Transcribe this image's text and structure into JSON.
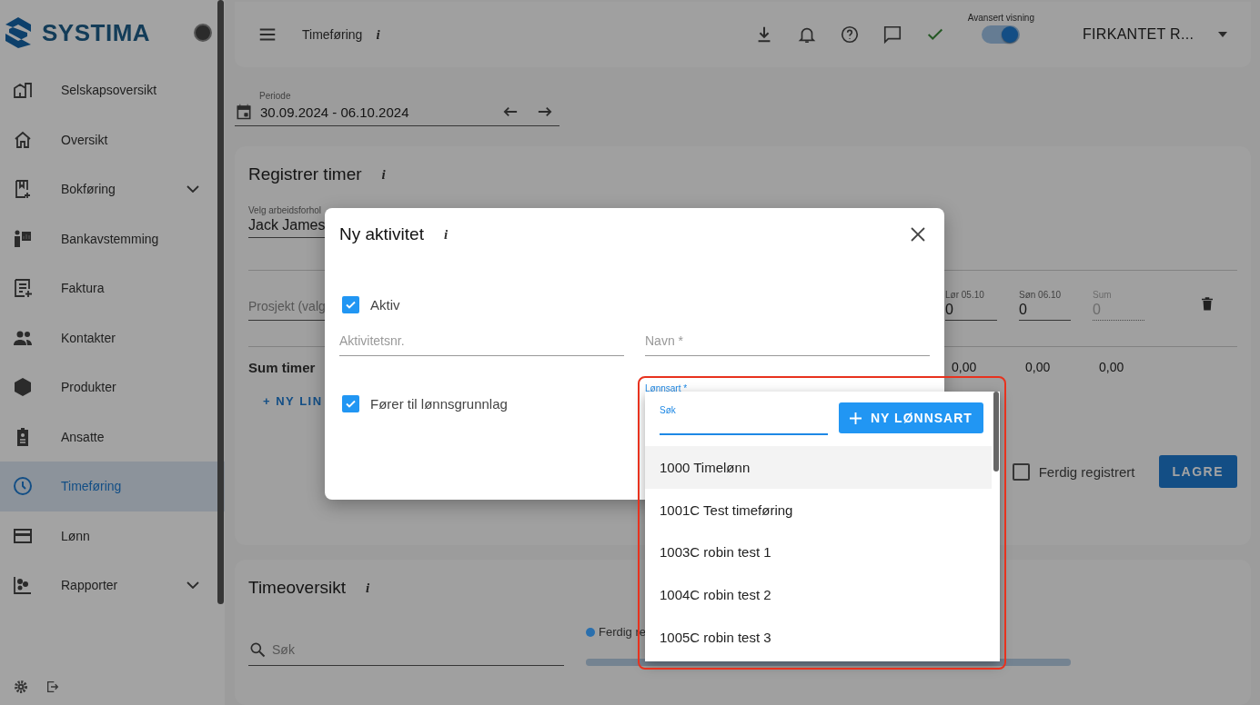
{
  "sidebar": {
    "logo": "SYSTIMA",
    "items": [
      {
        "label": "Selskapsoversikt",
        "selected": false,
        "expandable": false
      },
      {
        "label": "Oversikt",
        "selected": false,
        "expandable": false
      },
      {
        "label": "Bokføring",
        "selected": false,
        "expandable": true
      },
      {
        "label": "Bankavstemming",
        "selected": false,
        "expandable": false
      },
      {
        "label": "Faktura",
        "selected": false,
        "expandable": false
      },
      {
        "label": "Kontakter",
        "selected": false,
        "expandable": false
      },
      {
        "label": "Produkter",
        "selected": false,
        "expandable": false
      },
      {
        "label": "Ansatte",
        "selected": false,
        "expandable": false
      },
      {
        "label": "Timeføring",
        "selected": true,
        "expandable": false
      },
      {
        "label": "Lønn",
        "selected": false,
        "expandable": false
      },
      {
        "label": "Rapporter",
        "selected": false,
        "expandable": true
      }
    ]
  },
  "topbar": {
    "title": "Timeføring",
    "info": "i",
    "advanced_view": {
      "label": "Avansert visning",
      "on": true
    },
    "company": "FIRKANTET R..."
  },
  "period": {
    "label": "Periode",
    "value": "30.09.2024 - 06.10.2024"
  },
  "register": {
    "title": "Registrer timer",
    "info": "i",
    "employment": {
      "label": "Velg arbeidsforhol",
      "value": "Jack James"
    },
    "project": {
      "placeholder": "Prosjekt (valg"
    },
    "columns": [
      {
        "label": "Lør 05.10",
        "value": "0",
        "disabled": false
      },
      {
        "label": "Søn 06.10",
        "value": "0",
        "disabled": false
      },
      {
        "label": "Sum",
        "value": "0",
        "disabled": true
      }
    ],
    "sum_label": "Sum timer",
    "sums": [
      "0,00",
      "0,00",
      "0,00"
    ],
    "add_line": "+ NY LIN",
    "done": {
      "label": "Ferdig registrert",
      "checked": false
    },
    "save": "LAGRE"
  },
  "overview": {
    "title": "Timeoversikt",
    "info": "i",
    "search": {
      "placeholder": "Søk"
    },
    "legend": {
      "label": "Ferdig re",
      "color": "#2a6fad"
    },
    "progress": {
      "level": 1
    }
  },
  "dialog": {
    "title": "Ny aktivitet",
    "info": "i",
    "active": {
      "label": "Aktiv",
      "checked": true
    },
    "number": {
      "placeholder": "Aktivitetsnr."
    },
    "name": {
      "placeholder": "Navn *"
    },
    "payroll": {
      "label": "Fører til lønnsgrunnlag",
      "checked": true
    },
    "wage_type": {
      "label": "Lønnsart *"
    }
  },
  "dropdown": {
    "search_label": "Søk",
    "new_button": "NY LØNNSART",
    "options": [
      {
        "label": "1000 Timelønn",
        "selected": true
      },
      {
        "label": "1001C Test timeføring",
        "selected": false
      },
      {
        "label": "1003C robin test 1",
        "selected": false
      },
      {
        "label": "1004C robin test 2",
        "selected": false
      },
      {
        "label": "1005C robin test 3",
        "selected": false
      }
    ]
  }
}
